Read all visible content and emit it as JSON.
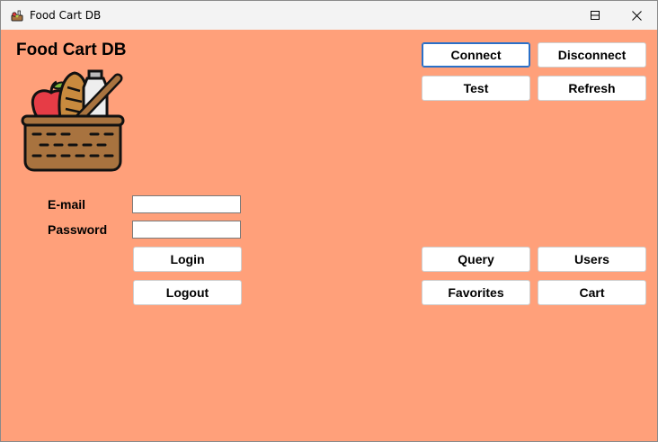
{
  "window": {
    "title": "Food Cart DB"
  },
  "app": {
    "title": "Food Cart DB",
    "logo_icon": "basket-icon"
  },
  "form": {
    "email_label": "E-mail",
    "email_value": "",
    "password_label": "Password",
    "password_value": ""
  },
  "buttons": {
    "connect": "Connect",
    "disconnect": "Disconnect",
    "test": "Test",
    "refresh": "Refresh",
    "login": "Login",
    "logout": "Logout",
    "query": "Query",
    "users": "Users",
    "favorites": "Favorites",
    "cart": "Cart"
  },
  "colors": {
    "background": "#ffa07a",
    "focus": "#2a70c8"
  }
}
